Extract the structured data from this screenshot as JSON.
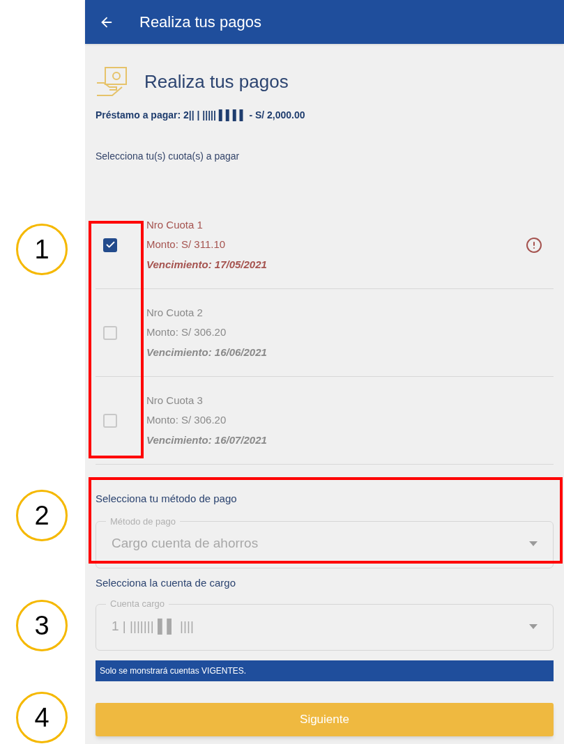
{
  "header": {
    "title": "Realiza tus pagos"
  },
  "page_title": "Realiza tus pagos",
  "loan": "Préstamo a pagar: 2|| | ||||| ▌▌▌▌ - S/ 2,000.00",
  "installments_prompt": "Selecciona tu(s) cuota(s) a pagar",
  "installments": [
    {
      "number": "Nro Cuota 1",
      "amount": "Monto: S/ 311.10",
      "due": "Vencimiento: 17/05/2021",
      "checked": true,
      "overdue": true
    },
    {
      "number": "Nro Cuota 2",
      "amount": "Monto: S/ 306.20",
      "due": "Vencimiento: 16/06/2021",
      "checked": false,
      "overdue": false
    },
    {
      "number": "Nro Cuota 3",
      "amount": "Monto: S/ 306.20",
      "due": "Vencimiento: 16/07/2021",
      "checked": false,
      "overdue": false
    }
  ],
  "method_prompt": "Selecciona tu método de pago",
  "method_field": {
    "label": "Método de pago",
    "value": "Cargo cuenta de ahorros"
  },
  "account_prompt": "Selecciona la cuenta de cargo",
  "account_field": {
    "label": "Cuenta cargo",
    "value": "1 | ||||||| ▌▌ ||||"
  },
  "notice": "Solo se monstrará cuentas VIGENTES.",
  "next_button": "Siguiente",
  "annotations": [
    {
      "label": "1"
    },
    {
      "label": "2"
    },
    {
      "label": "3"
    },
    {
      "label": "4"
    }
  ]
}
